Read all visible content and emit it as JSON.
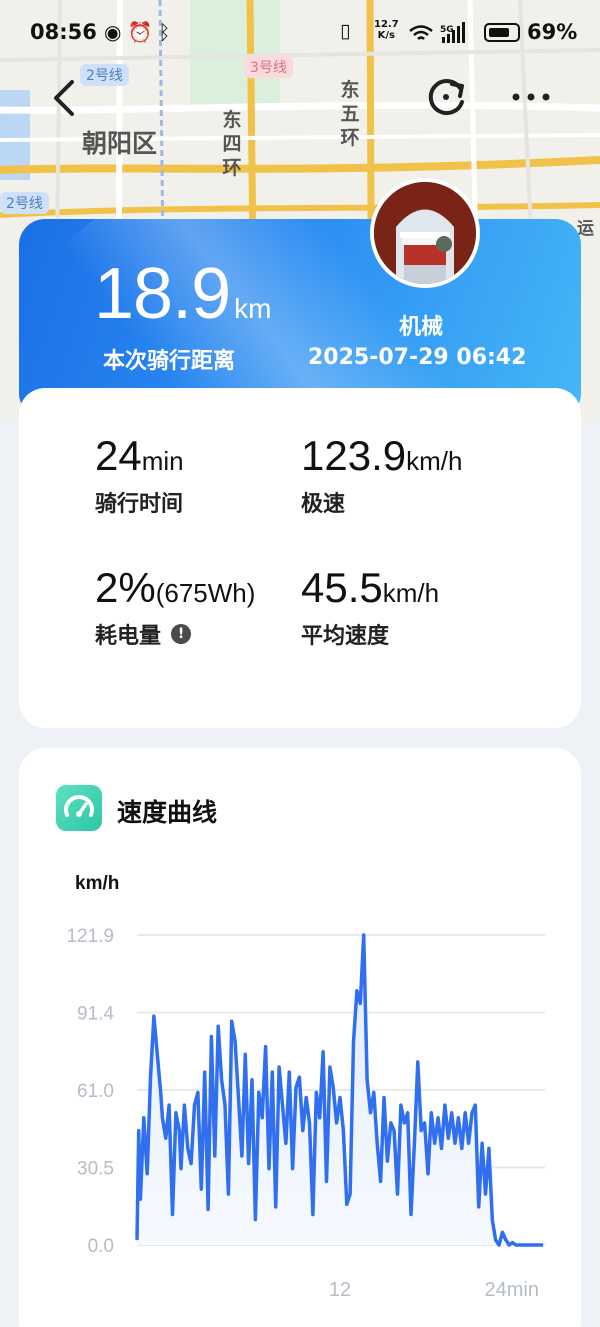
{
  "status_bar": {
    "time": "08:56",
    "net_speed_top": "12.7",
    "net_speed_bottom": "K/s",
    "battery_pct": "69%"
  },
  "map": {
    "district": "朝阳区",
    "ring_east4": "东四环",
    "ring_east5": "东五环",
    "line_2_a": "2号线",
    "line_3": "3号线",
    "line_2_b": "2号线",
    "edge_text": "运"
  },
  "hero": {
    "distance_value": "18.9",
    "distance_unit": "km",
    "distance_label": "本次骑行距离",
    "rider_name": "机械",
    "datetime": "2025-07-29 06:42"
  },
  "stats": {
    "time": {
      "value": "24",
      "unit": "min",
      "label": "骑行时间"
    },
    "top_speed": {
      "value": "123.9",
      "unit": "km/h",
      "label": "极速"
    },
    "energy": {
      "value": "2%",
      "unit": "(675Wh)",
      "label": "耗电量"
    },
    "avg_speed": {
      "value": "45.5",
      "unit": "km/h",
      "label": "平均速度"
    }
  },
  "chart_section": {
    "title": "速度曲线",
    "icon": "speedometer-icon"
  },
  "colors": {
    "accent": "#2f6ff0",
    "hero_start": "#1b6fe6",
    "hero_end": "#46b7f7",
    "chart_icon": "#3cd2b2"
  },
  "chart_data": {
    "type": "line",
    "ylabel": "km/h",
    "xlabel": "",
    "ylim": [
      0,
      121.9
    ],
    "xlim": [
      0,
      24
    ],
    "y_ticks": [
      "121.9",
      "91.4",
      "61.0",
      "30.5",
      "0.0"
    ],
    "x_ticks": [
      "12",
      "24min"
    ],
    "x_tick_values": [
      12,
      24
    ],
    "grid": true,
    "series": [
      {
        "values_x": [
          0,
          0.1,
          0.2,
          0.4,
          0.6,
          0.8,
          1.0,
          1.2,
          1.4,
          1.5,
          1.7,
          1.9,
          2.1,
          2.3,
          2.5,
          2.6,
          2.8,
          3.0,
          3.2,
          3.4,
          3.6,
          3.8,
          4.0,
          4.2,
          4.4,
          4.6,
          4.8,
          5.0,
          5.2,
          5.4,
          5.6,
          5.8,
          6.0,
          6.2,
          6.4,
          6.6,
          6.8,
          7.0,
          7.2,
          7.4,
          7.6,
          7.8,
          8.0,
          8.2,
          8.4,
          8.6,
          8.8,
          9.0,
          9.2,
          9.4,
          9.6,
          9.8,
          10.0,
          10.2,
          10.4,
          10.6,
          10.8,
          11.0,
          11.2,
          11.4,
          11.6,
          11.8,
          12.0,
          12.2,
          12.4,
          12.6,
          12.8,
          13.0,
          13.2,
          13.4,
          13.6,
          13.8,
          14.0,
          14.2,
          14.4,
          14.6,
          14.8,
          15.0,
          15.2,
          15.4,
          15.6,
          15.8,
          16.0,
          16.2,
          16.4,
          16.6,
          16.8,
          17.0,
          17.2,
          17.4,
          17.6,
          17.8,
          18.0,
          18.2,
          18.4,
          18.6,
          18.8,
          19.0,
          19.2,
          19.4,
          19.6,
          19.8,
          20.0,
          20.2,
          20.4,
          20.6,
          20.8,
          21.0,
          21.2,
          21.4,
          21.6,
          21.8,
          22.0,
          22.2,
          22.4,
          22.6,
          22.8,
          23.0,
          23.2,
          23.4,
          23.6,
          23.8,
          24.0
        ],
        "values": [
          2,
          45,
          18,
          50,
          28,
          66,
          90,
          75,
          60,
          50,
          42,
          55,
          12,
          52,
          45,
          30,
          55,
          38,
          32,
          55,
          60,
          22,
          68,
          14,
          82,
          35,
          86,
          65,
          55,
          20,
          88,
          80,
          58,
          35,
          75,
          32,
          65,
          10,
          60,
          50,
          78,
          30,
          68,
          15,
          70,
          55,
          40,
          68,
          30,
          62,
          66,
          45,
          58,
          48,
          12,
          60,
          50,
          76,
          25,
          70,
          62,
          48,
          58,
          45,
          16,
          20,
          80,
          100,
          95,
          121.9,
          65,
          52,
          60,
          40,
          25,
          58,
          33,
          48,
          45,
          20,
          55,
          48,
          52,
          12,
          40,
          72,
          45,
          48,
          28,
          52,
          40,
          50,
          38,
          55,
          42,
          52,
          40,
          50,
          38,
          52,
          40,
          52,
          55,
          15,
          40,
          20,
          38,
          10,
          2,
          0,
          5,
          2,
          0,
          1,
          0,
          0,
          0,
          0,
          0,
          0,
          0,
          0,
          0
        ]
      }
    ]
  }
}
